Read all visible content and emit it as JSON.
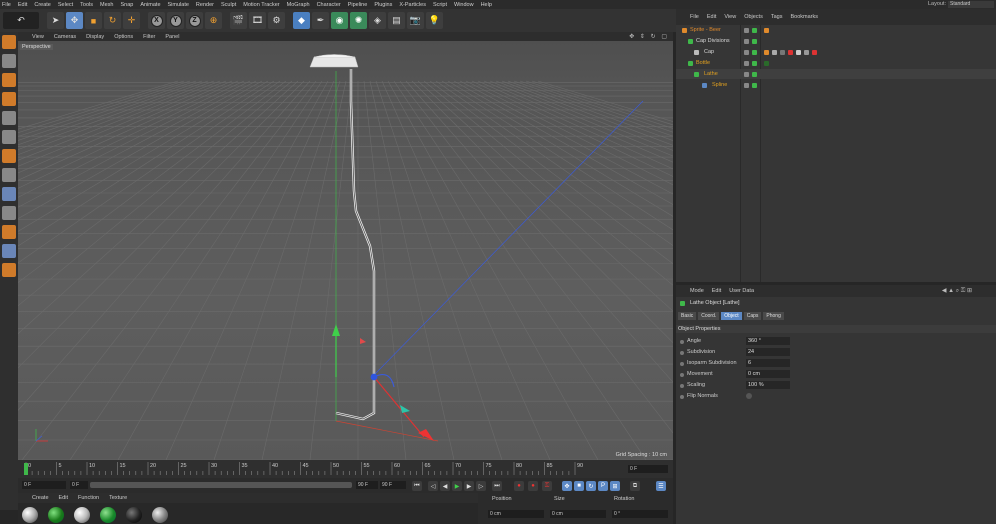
{
  "menubar": {
    "items": [
      "File",
      "Edit",
      "Create",
      "Select",
      "Tools",
      "Mesh",
      "Snap",
      "Animate",
      "Simulate",
      "Render",
      "Sculpt",
      "Motion Tracker",
      "MoGraph",
      "Character",
      "Pipeline",
      "Plugins",
      "X-Particles",
      "Script",
      "Window",
      "Help"
    ],
    "layout_label": "Layout:",
    "layout_value": "Standard"
  },
  "viewport": {
    "menu": [
      "View",
      "Cameras",
      "Display",
      "Options",
      "Filter",
      "Panel"
    ],
    "label": "Perspective",
    "grid_spacing": "Grid Spacing : 10 cm"
  },
  "timeline": {
    "ticks": [
      "0",
      "5",
      "10",
      "15",
      "20",
      "25",
      "30",
      "35",
      "40",
      "45",
      "50",
      "55",
      "60",
      "65",
      "70",
      "75",
      "80",
      "85",
      "90"
    ],
    "end_frame": "0 F",
    "current_frame": "0 F",
    "min_frame": "0 F",
    "max_frame": "90 F",
    "max_frame_2": "90 F"
  },
  "materials": {
    "menu": [
      "Create",
      "Edit",
      "Function",
      "Texture"
    ]
  },
  "coordinates": {
    "headers": [
      "Position",
      "Size",
      "Rotation"
    ],
    "pos_x": "0 cm",
    "size_x": "0 cm",
    "rot_h": "0 °"
  },
  "object_manager": {
    "menu": [
      "File",
      "Edit",
      "View",
      "Objects",
      "Tags",
      "Bookmarks"
    ],
    "rows": [
      {
        "name": "Sprite - Beer",
        "color": "#e08a2c"
      },
      {
        "name": "Cap Divisions",
        "color": "#d6d6d6"
      },
      {
        "name": "Cap",
        "color": "#d6d6d6"
      },
      {
        "name": "Bottle",
        "color": "#e0a020"
      },
      {
        "name": "Lathe",
        "color": "#e0a020"
      },
      {
        "name": "Spline",
        "color": "#e0a020"
      }
    ]
  },
  "attribute_manager": {
    "menu": [
      "Mode",
      "Edit",
      "User Data"
    ],
    "title": "Lathe Object [Lathe]",
    "tabs": [
      "Basic",
      "Coord.",
      "Object",
      "Caps",
      "Phong"
    ],
    "active_tab": "Object",
    "section": "Object Properties",
    "properties": [
      {
        "label": "Angle",
        "value": "360 °"
      },
      {
        "label": "Subdivision",
        "value": "24"
      },
      {
        "label": "Isoparm Subdivision",
        "value": "6"
      },
      {
        "label": "Movement",
        "value": "0 cm"
      },
      {
        "label": "Scaling",
        "value": "100 %"
      },
      {
        "label": "Flip Normals",
        "value": ""
      }
    ]
  },
  "colors": {
    "accent": "#5c88c4",
    "orange": "#e08a2c",
    "grid": "#6a6a6a",
    "y_axis": "#3fb84a",
    "x_axis": "#d33",
    "z_axis": "#3b5bd9"
  }
}
